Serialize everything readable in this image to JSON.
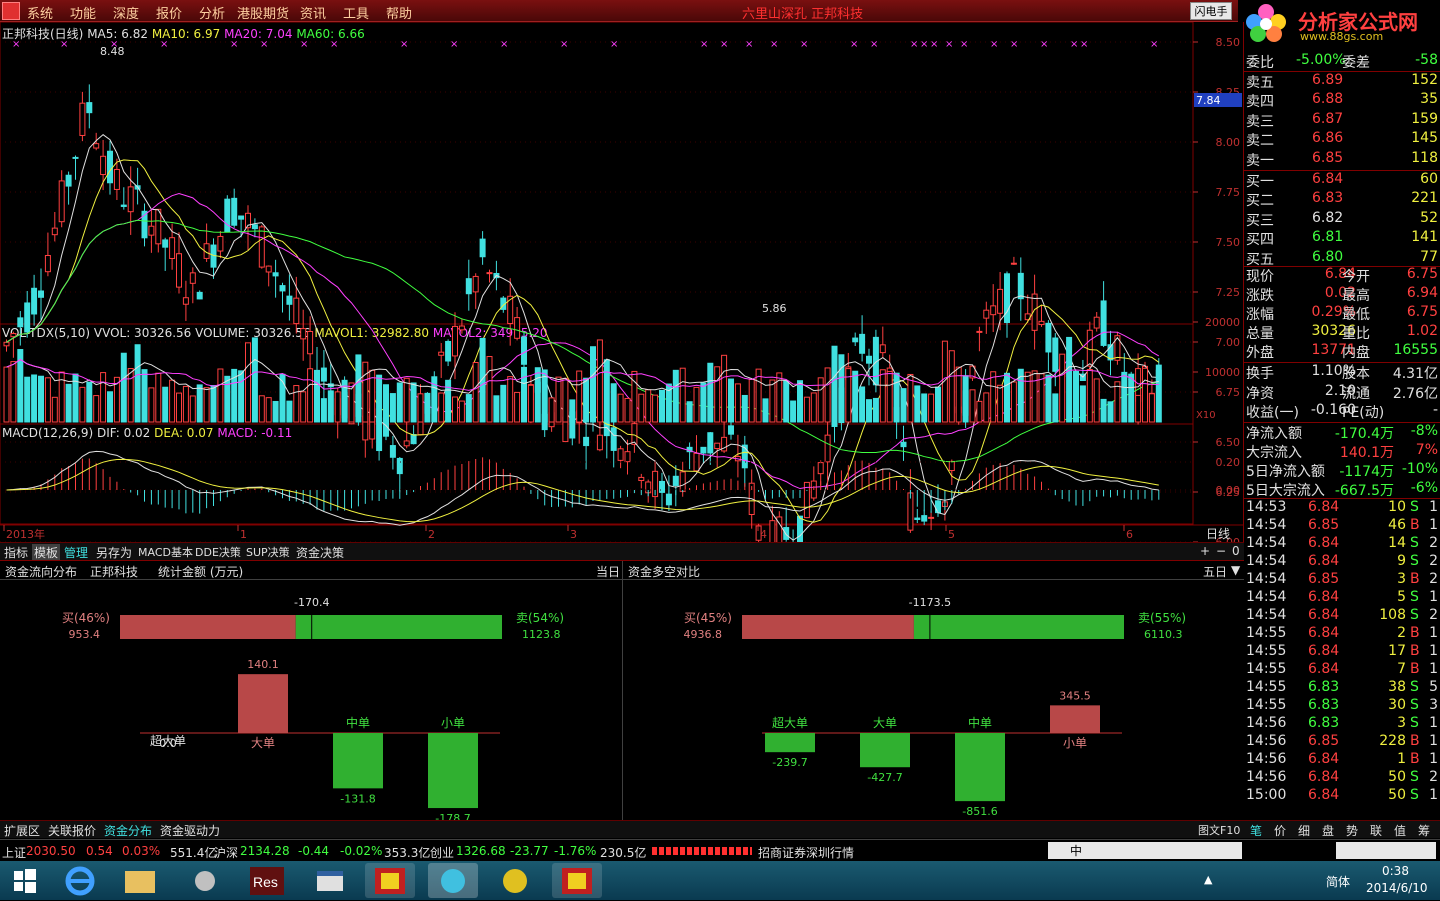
{
  "menu": {
    "items": [
      "系统",
      "功能",
      "深度",
      "报价",
      "分析",
      "港股期货",
      "资讯",
      "工具",
      "帮助"
    ],
    "marquee": "六里山深孔 正邦科技",
    "flash_button": "闪电手"
  },
  "brand": {
    "title": "分析家公式网",
    "url": "www.88gs.com"
  },
  "main_chart": {
    "label": "正邦科技(日线)",
    "ma5": "MA5: 6.82",
    "ma10": "MA10: 6.97",
    "ma20": "MA20: 7.04",
    "ma60": "MA60: 6.66",
    "high_label": "8.48",
    "low_label": "5.86",
    "price_marker": "7.84",
    "yticks": [
      "8.50",
      "8.25",
      "8.00",
      "7.75",
      "7.50",
      "7.25",
      "7.00",
      "6.75",
      "6.50",
      "6.25",
      "6.00"
    ]
  },
  "vol_chart": {
    "label": "VOL-TDX(5,10)",
    "vvol": "VVOL: 30326.56",
    "volume": "VOLUME: 30326.56",
    "mavol1": "MAVOL1: 32982.80",
    "mavol2": "MAVOL2: 34965.20",
    "yticks": [
      "20000",
      "10000"
    ],
    "scale": "X10"
  },
  "macd_chart": {
    "label": "MACD(12,26,9)",
    "dif": "DIF: 0.02",
    "dea": "DEA: 0.07",
    "macd": "MACD: -0.11",
    "yticks": [
      "0.20",
      "0.00"
    ]
  },
  "xaxis": {
    "labels": [
      "2013年",
      "1",
      "2",
      "3",
      "4",
      "5",
      "6"
    ],
    "period": "日线"
  },
  "tabs": [
    "指标",
    "模板",
    "管理",
    "另存为",
    "MACD基本",
    "DDE决策",
    "SUP决策",
    "资金决策"
  ],
  "tab_controls": [
    "+",
    "−",
    "0"
  ],
  "money": {
    "left_title": "资金流向分布",
    "stock": "正邦科技",
    "unit": "统计金额 (万元)",
    "left_period": "当日",
    "right_title": "资金多空对比",
    "right_period": "五日",
    "left_bar": {
      "net": "-170.4",
      "buy_pct": "买(46%)",
      "buy_val": "953.4",
      "sell_pct": "卖(54%)",
      "sell_val": "1123.8",
      "buy_ratio": 0.46
    },
    "right_bar": {
      "net": "-1173.5",
      "buy_pct": "买(45%)",
      "buy_val": "4936.8",
      "sell_pct": "卖(55%)",
      "sell_val": "6110.3",
      "buy_ratio": 0.45
    },
    "left_bars": [
      {
        "name": "超大单",
        "value": "0.0",
        "num": 0
      },
      {
        "name": "大单",
        "value": "140.1",
        "num": 140.1
      },
      {
        "name": "中单",
        "value": "-131.8",
        "num": -131.8
      },
      {
        "name": "小单",
        "value": "-178.7",
        "num": -178.7
      }
    ],
    "right_bars": [
      {
        "name": "超大单",
        "value": "-239.7",
        "num": -239.7
      },
      {
        "name": "大单",
        "value": "-427.7",
        "num": -427.7
      },
      {
        "name": "中单",
        "value": "-851.6",
        "num": -851.6
      },
      {
        "name": "小单",
        "value": "345.5",
        "num": 345.5
      }
    ]
  },
  "bottom_tabs": [
    "扩展区",
    "关联报价",
    "资金分布",
    "资金驱动力"
  ],
  "right_bottom_tabs": [
    "图文F10",
    "笔",
    "价",
    "细",
    "盘",
    "势",
    "联",
    "值",
    "筹"
  ],
  "quote": {
    "header": [
      "委比",
      "-5.00%",
      "委差",
      "-58"
    ],
    "asks": [
      [
        "卖五",
        "6.89",
        "152"
      ],
      [
        "卖四",
        "6.88",
        "35"
      ],
      [
        "卖三",
        "6.87",
        "159"
      ],
      [
        "卖二",
        "6.86",
        "145"
      ],
      [
        "卖一",
        "6.85",
        "118"
      ]
    ],
    "bids": [
      [
        "买一",
        "6.84",
        "60"
      ],
      [
        "买二",
        "6.83",
        "221"
      ],
      [
        "买三",
        "6.82",
        "52"
      ],
      [
        "买四",
        "6.81",
        "141"
      ],
      [
        "买五",
        "6.80",
        "77"
      ]
    ],
    "stats": [
      [
        "现价",
        "6.84",
        "今开",
        "6.75"
      ],
      [
        "涨跌",
        "0.02",
        "最高",
        "6.94"
      ],
      [
        "涨幅",
        "0.29%",
        "最低",
        "6.75"
      ],
      [
        "总量",
        "30326",
        "量比",
        "1.02"
      ],
      [
        "外盘",
        "13771",
        "内盘",
        "16555"
      ]
    ],
    "stats2": [
      [
        "换手",
        "1.10%",
        "股本",
        "4.31亿"
      ],
      [
        "净资",
        "2.10",
        "流通",
        "2.76亿"
      ],
      [
        "收益(一)",
        "-0.160",
        "PE(动)",
        "-"
      ]
    ],
    "flows": [
      [
        "净流入额",
        "-170.4万",
        "-8%"
      ],
      [
        "大宗流入",
        "140.1万",
        "7%"
      ],
      [
        "5日净流入额",
        "-1174万",
        "-10%"
      ],
      [
        "5日大宗流入",
        "-667.5万",
        "-6%"
      ]
    ],
    "ticks": [
      [
        "14:53",
        "6.84",
        "10",
        "S",
        "1"
      ],
      [
        "14:54",
        "6.85",
        "46",
        "B",
        "1"
      ],
      [
        "14:54",
        "6.84",
        "14",
        "S",
        "2"
      ],
      [
        "14:54",
        "6.84",
        "9",
        "S",
        "2"
      ],
      [
        "14:54",
        "6.85",
        "3",
        "B",
        "2"
      ],
      [
        "14:54",
        "6.84",
        "5",
        "S",
        "1"
      ],
      [
        "14:54",
        "6.84",
        "108",
        "S",
        "2"
      ],
      [
        "14:55",
        "6.84",
        "2",
        "B",
        "1"
      ],
      [
        "14:55",
        "6.84",
        "17",
        "B",
        "1"
      ],
      [
        "14:55",
        "6.84",
        "7",
        "B",
        "1"
      ],
      [
        "14:55",
        "6.83",
        "38",
        "S",
        "5"
      ],
      [
        "14:55",
        "6.83",
        "30",
        "S",
        "3"
      ],
      [
        "14:56",
        "6.83",
        "3",
        "S",
        "1"
      ],
      [
        "14:56",
        "6.85",
        "228",
        "B",
        "1"
      ],
      [
        "14:56",
        "6.84",
        "1",
        "B",
        "1"
      ],
      [
        "14:56",
        "6.84",
        "50",
        "S",
        "2"
      ],
      [
        "15:00",
        "6.84",
        "50",
        "S",
        "1"
      ]
    ]
  },
  "ticker": {
    "sh_label": "上证",
    "sh_val": "2030.50",
    "sh_chg": "0.54",
    "sh_pct": "0.03%",
    "sh_amt": "551.4亿",
    "sz_label": "沪深",
    "sz_val": "2134.28",
    "sz_chg": "-0.44",
    "sz_pct": "-0.02%",
    "sz_amt": "353.3亿",
    "cy_label": "创业",
    "cy_val": "1326.68",
    "cy_chg": "-23.77",
    "cy_pct": "-1.76%",
    "cy_amt": "230.5亿",
    "broker": "招商证券深圳行情",
    "ime": "中"
  },
  "taskbar": {
    "lang": "简体",
    "time": "0:38",
    "date": "2014/6/10"
  },
  "colors": {
    "up": "#ff4040",
    "down": "#40e0e0",
    "panel_border": "#800000",
    "ma5": "#e0e0e0",
    "ma10": "#f0f040",
    "ma20": "#ff40ff",
    "ma60": "#40ff40"
  }
}
